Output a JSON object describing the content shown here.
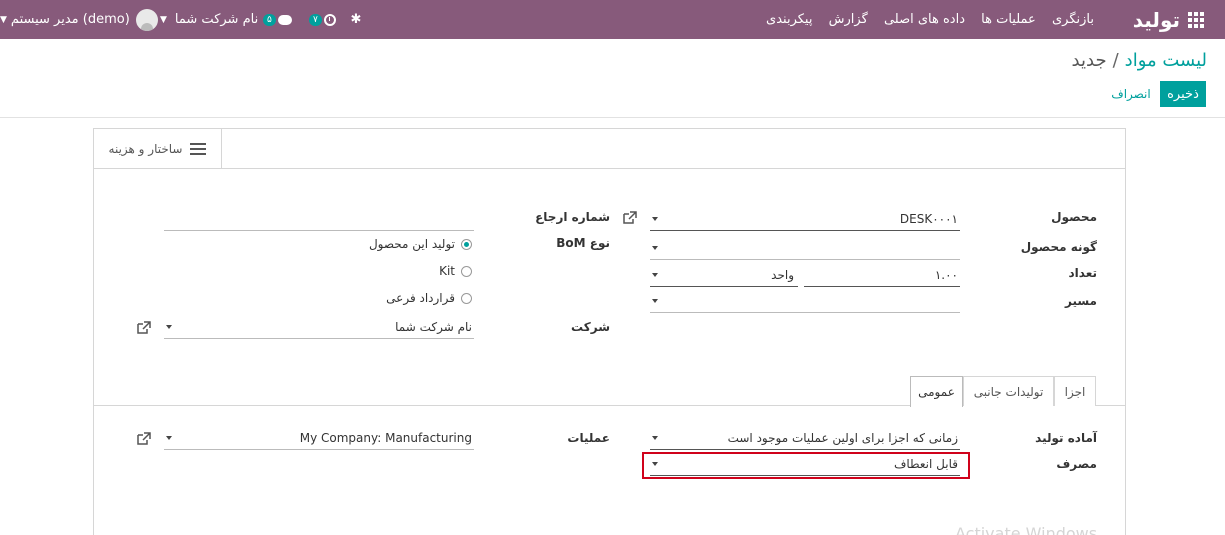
{
  "navbar": {
    "brand": "تولید",
    "menu": [
      "بازنگری",
      "عملیات ها",
      "داده های اصلی",
      "گزارش",
      "پیکربندی"
    ],
    "activity_count": "۷",
    "message_count": "۵",
    "company": "نام شرکت شما",
    "user": "مدیر سیستم (demo)"
  },
  "breadcrumb": {
    "parent": "لیست مواد",
    "separator": "/",
    "current": "جدید"
  },
  "buttons": {
    "save": "ذخیره",
    "discard": "انصراف"
  },
  "stat_button": {
    "label": "ساختار و هزینه"
  },
  "form": {
    "product": {
      "label": "محصول",
      "value": "DESK۰۰۰۱"
    },
    "product_variant": {
      "label": "گونه محصول",
      "value": ""
    },
    "quantity": {
      "label": "تعداد",
      "value": "۱.۰۰",
      "uom": "واحد"
    },
    "routing": {
      "label": "مسیر",
      "value": ""
    },
    "reference": {
      "label": "شماره ارجاع",
      "value": ""
    },
    "bom_type": {
      "label": "نوع BoM",
      "options": [
        "تولید این محصول",
        "Kit",
        "قرارداد فرعی"
      ],
      "selected": "تولید این محصول"
    },
    "company": {
      "label": "شرکت",
      "value": "نام شرکت شما"
    }
  },
  "tabs": [
    "اجزا",
    "تولیدات جانبی",
    "عمومی"
  ],
  "active_tab": "عمومی",
  "general": {
    "ready_to_produce": {
      "label": "آماده تولید",
      "value": "زمانی که اجزا برای اولین عملیات موجود است"
    },
    "consumption": {
      "label": "مصرف",
      "value": "قابل انعطاف"
    },
    "operation": {
      "label": "عملیات",
      "value": "My Company: Manufacturing"
    }
  },
  "watermark": "Activate Windows",
  "colors": {
    "navbar": "#875a7b",
    "accent": "#00a09d",
    "highlight": "#d0021b"
  }
}
